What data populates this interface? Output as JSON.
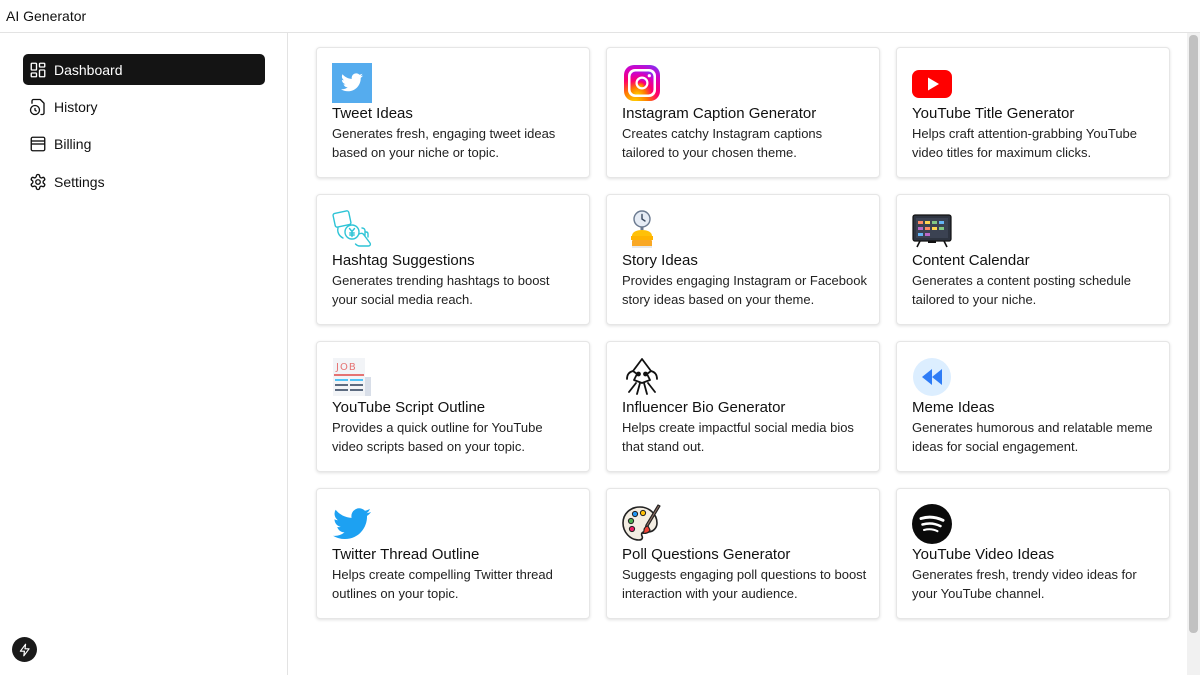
{
  "app": {
    "title": "AI Generator"
  },
  "sidebar": {
    "items": [
      {
        "label": "Dashboard",
        "icon": "dashboard-icon",
        "active": true
      },
      {
        "label": "History",
        "icon": "history-icon",
        "active": false
      },
      {
        "label": "Billing",
        "icon": "billing-icon",
        "active": false
      },
      {
        "label": "Settings",
        "icon": "settings-icon",
        "active": false
      }
    ]
  },
  "templates": [
    {
      "title": "Tweet Ideas",
      "desc": "Generates fresh, engaging tweet ideas based on your niche or topic.",
      "icon": "twitter-square-icon"
    },
    {
      "title": "Instagram Caption Generator",
      "desc": "Creates catchy Instagram captions tailored to your chosen theme.",
      "icon": "instagram-icon"
    },
    {
      "title": "YouTube Title Generator",
      "desc": "Helps craft attention-grabbing YouTube video titles for maximum clicks.",
      "icon": "youtube-icon"
    },
    {
      "title": "Hashtag Suggestions",
      "desc": "Generates trending hashtags to boost your social media reach.",
      "icon": "hashtag-money-icon"
    },
    {
      "title": "Story Ideas",
      "desc": "Provides engaging Instagram or Facebook story ideas based on your theme.",
      "icon": "story-timer-icon"
    },
    {
      "title": "Content Calendar",
      "desc": "Generates a content posting schedule tailored to your niche.",
      "icon": "calendar-board-icon"
    },
    {
      "title": "YouTube Script Outline",
      "desc": "Provides a quick outline for YouTube video scripts based on your topic.",
      "icon": "job-newspaper-icon"
    },
    {
      "title": "Influencer Bio Generator",
      "desc": "Helps create impactful social media bios that stand out.",
      "icon": "squid-icon"
    },
    {
      "title": "Meme Ideas",
      "desc": "Generates humorous and relatable meme ideas for social engagement.",
      "icon": "rewind-icon"
    },
    {
      "title": "Twitter Thread Outline",
      "desc": "Helps create compelling Twitter thread outlines on your topic.",
      "icon": "twitter-bird-icon"
    },
    {
      "title": "Poll Questions Generator",
      "desc": "Suggests engaging poll questions to boost interaction with your audience.",
      "icon": "palette-icon"
    },
    {
      "title": "YouTube Video Ideas",
      "desc": "Generates fresh, trendy video ideas for your YouTube channel.",
      "icon": "spotify-icon"
    }
  ],
  "colors": {
    "active_nav_bg": "#141414",
    "twitter_blue": "#1DA1F2",
    "youtube_red": "#FF0000"
  }
}
